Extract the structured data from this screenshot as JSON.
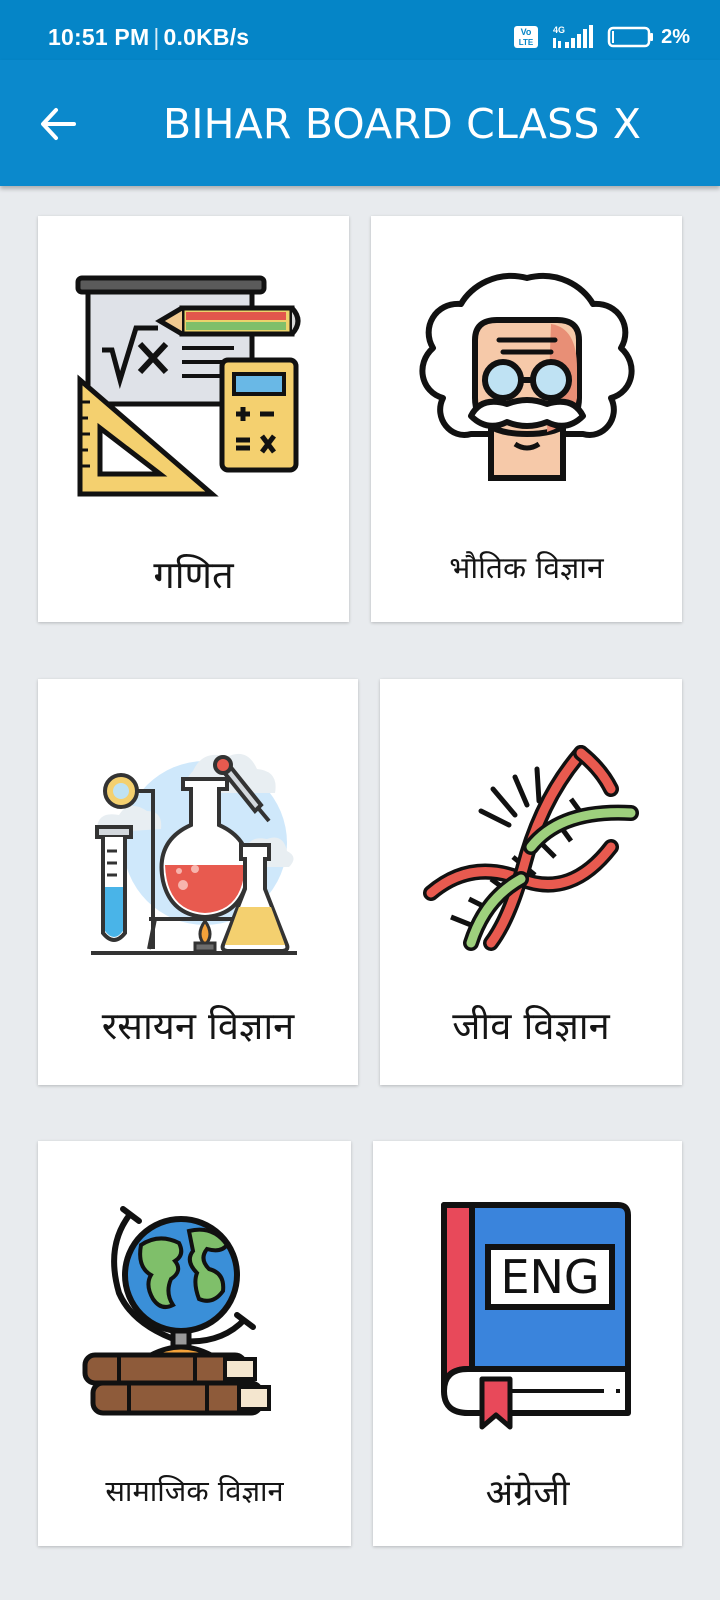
{
  "status": {
    "time": "10:51 PM",
    "speed": "0.0KB/s",
    "volte": "Vo LTE",
    "network": "4G",
    "battery": "2%"
  },
  "appbar": {
    "title": "BIHAR BOARD CLASS X"
  },
  "subjects": [
    {
      "label": "गणित"
    },
    {
      "label": "भौतिक विज्ञान"
    },
    {
      "label": "रसायन विज्ञान"
    },
    {
      "label": "जीव विज्ञान"
    },
    {
      "label": "सामाजिक विज्ञान"
    },
    {
      "label": "अंग्रेजी"
    }
  ],
  "english_badge": "ENG",
  "icons": {
    "math": "math-board-icon",
    "physics": "einstein-icon",
    "chemistry": "lab-flasks-icon",
    "biology": "dna-icon",
    "social": "globe-books-icon",
    "english": "english-book-icon"
  }
}
